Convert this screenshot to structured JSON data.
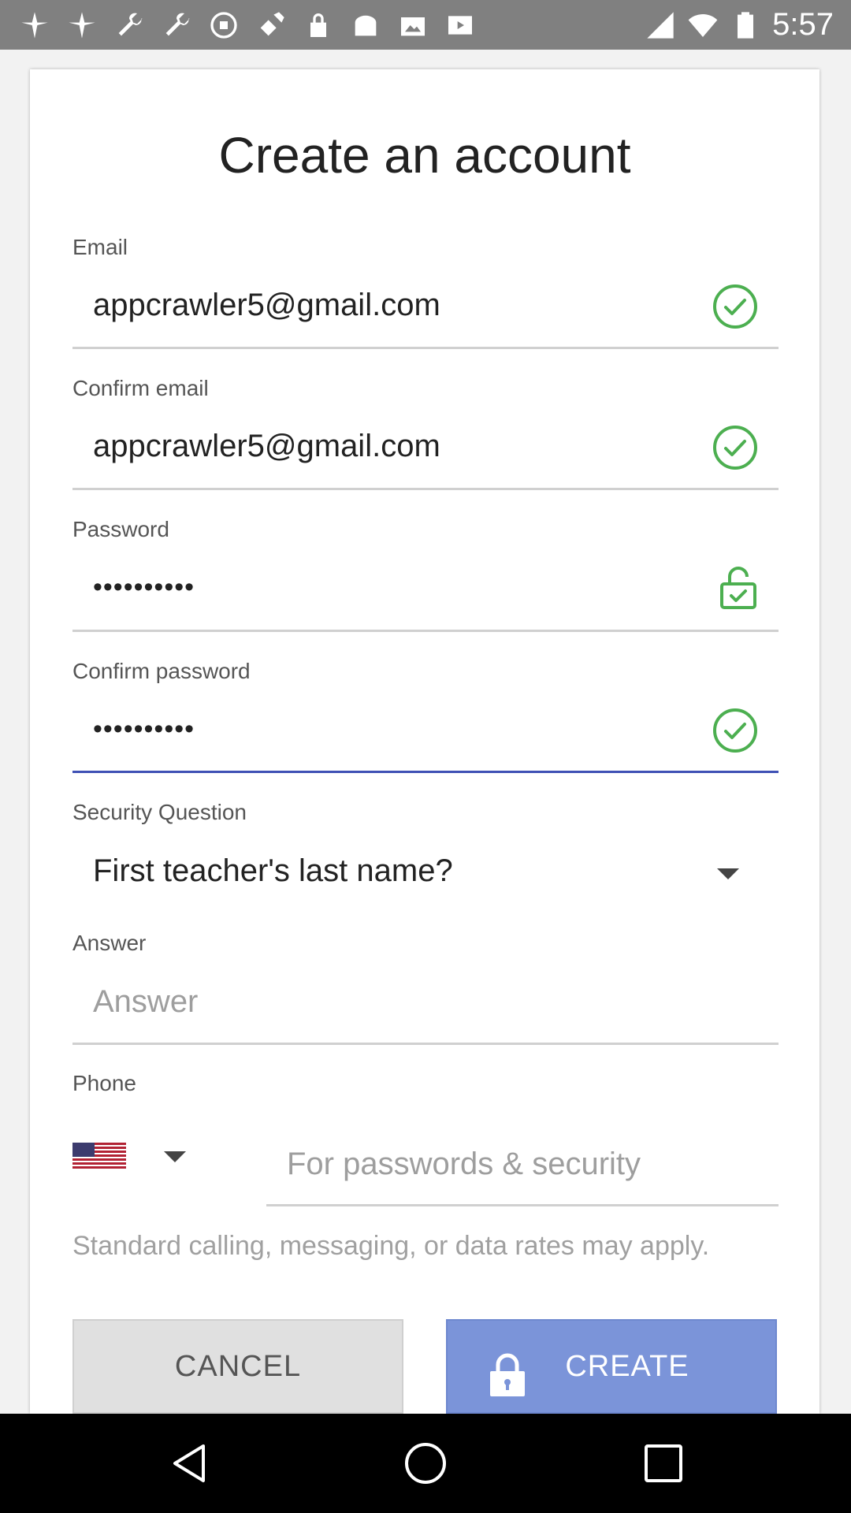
{
  "status_bar": {
    "time": "5:57",
    "left_icons": [
      "pinwheel-icon",
      "pinwheel-icon",
      "wrench-icon",
      "wrench-icon",
      "no-sim-icon",
      "satellite-icon",
      "lock-icon",
      "toast-icon",
      "photo-icon",
      "play-icon"
    ],
    "right_icons": [
      "signal-icon",
      "wifi-icon",
      "battery-icon"
    ]
  },
  "form": {
    "title": "Create an account",
    "email": {
      "label": "Email",
      "value": "appcrawler5@gmail.com"
    },
    "confirm_email": {
      "label": "Confirm email",
      "value": "appcrawler5@gmail.com"
    },
    "password": {
      "label": "Password",
      "value": "••••••••••"
    },
    "confirm_password": {
      "label": "Confirm password",
      "value": "••••••••••"
    },
    "security_question": {
      "label": "Security Question",
      "value": "First teacher's last name?"
    },
    "answer": {
      "label": "Answer",
      "placeholder": "Answer"
    },
    "phone": {
      "label": "Phone",
      "placeholder": "For passwords & security",
      "country": "US"
    },
    "note": "Standard calling, messaging, or data rates may apply.",
    "cancel_label": "CANCEL",
    "create_label": "CREATE"
  },
  "colors": {
    "accent": "#3f51b5",
    "check_green": "#4caf50",
    "create_button": "#7b94d9"
  }
}
